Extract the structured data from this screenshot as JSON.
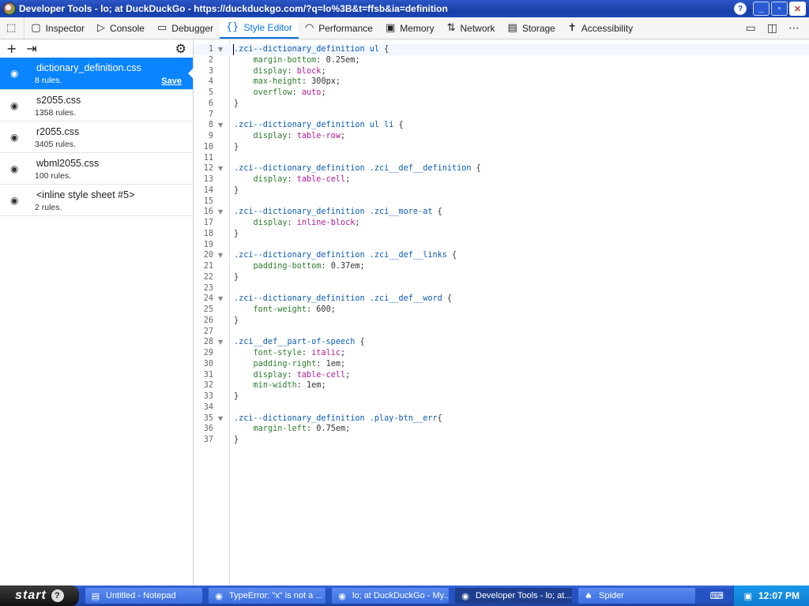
{
  "window": {
    "title": "Developer Tools - lo; at DuckDuckGo - https://duckduckgo.com/?q=lo%3B&t=ffsb&ia=definition",
    "help_glyph": "?",
    "minimize_glyph": "_",
    "maximize_glyph": "▫",
    "close_glyph": "✕"
  },
  "toolbar": {
    "tabs": [
      {
        "label": "Inspector",
        "icon": "inspector-icon",
        "glyph": "▢"
      },
      {
        "label": "Console",
        "icon": "console-icon",
        "glyph": "▷"
      },
      {
        "label": "Debugger",
        "icon": "debugger-icon",
        "glyph": "▭"
      },
      {
        "label": "Style Editor",
        "icon": "style-editor-icon",
        "glyph": "{}"
      },
      {
        "label": "Performance",
        "icon": "performance-icon",
        "glyph": "◠"
      },
      {
        "label": "Memory",
        "icon": "memory-icon",
        "glyph": "▣"
      },
      {
        "label": "Network",
        "icon": "network-icon",
        "glyph": "⇅"
      },
      {
        "label": "Storage",
        "icon": "storage-icon",
        "glyph": "▤"
      },
      {
        "label": "Accessibility",
        "icon": "accessibility-icon",
        "glyph": "✝"
      }
    ],
    "active_tab": "Style Editor",
    "accent_color": "#0a72e0"
  },
  "sidebar": {
    "sheets": [
      {
        "name": "dictionary_definition.css",
        "rules": "8 rules.",
        "selected": true,
        "save_label": "Save"
      },
      {
        "name": "s2055.css",
        "rules": "1358 rules."
      },
      {
        "name": "r2055.css",
        "rules": "3405 rules."
      },
      {
        "name": "wbml2055.css",
        "rules": "100 rules."
      },
      {
        "name": "<inline style sheet #5>",
        "rules": "2 rules."
      }
    ],
    "selected_color": "#0a84ff"
  },
  "editor": {
    "lines": [
      {
        "n": "1",
        "fold": true,
        "tokens": [
          [
            "sel",
            ".zci--dictionary_definition ul"
          ],
          [
            "pun",
            " {"
          ]
        ]
      },
      {
        "n": "2",
        "tokens": [
          [
            "pun",
            "    "
          ],
          [
            "prop",
            "margin-bottom"
          ],
          [
            "pun",
            ": "
          ],
          [
            "pun",
            "0.25em"
          ],
          [
            "pun",
            ";"
          ]
        ]
      },
      {
        "n": "3",
        "tokens": [
          [
            "pun",
            "    "
          ],
          [
            "prop",
            "display"
          ],
          [
            "pun",
            ": "
          ],
          [
            "val",
            "block"
          ],
          [
            "pun",
            ";"
          ]
        ]
      },
      {
        "n": "4",
        "tokens": [
          [
            "pun",
            "    "
          ],
          [
            "prop",
            "max-height"
          ],
          [
            "pun",
            ": "
          ],
          [
            "pun",
            "300px"
          ],
          [
            "pun",
            ";"
          ]
        ]
      },
      {
        "n": "5",
        "tokens": [
          [
            "pun",
            "    "
          ],
          [
            "prop",
            "overflow"
          ],
          [
            "pun",
            ": "
          ],
          [
            "val",
            "auto"
          ],
          [
            "pun",
            ";"
          ]
        ]
      },
      {
        "n": "6",
        "tokens": [
          [
            "pun",
            "}"
          ]
        ]
      },
      {
        "n": "7",
        "tokens": []
      },
      {
        "n": "8",
        "fold": true,
        "tokens": [
          [
            "sel",
            ".zci--dictionary_definition ul li"
          ],
          [
            "pun",
            " {"
          ]
        ]
      },
      {
        "n": "9",
        "tokens": [
          [
            "pun",
            "    "
          ],
          [
            "prop",
            "display"
          ],
          [
            "pun",
            ": "
          ],
          [
            "val",
            "table-row"
          ],
          [
            "pun",
            ";"
          ]
        ]
      },
      {
        "n": "10",
        "tokens": [
          [
            "pun",
            "}"
          ]
        ]
      },
      {
        "n": "11",
        "tokens": []
      },
      {
        "n": "12",
        "fold": true,
        "tokens": [
          [
            "sel",
            ".zci--dictionary_definition .zci__def__definition"
          ],
          [
            "pun",
            " {"
          ]
        ]
      },
      {
        "n": "13",
        "tokens": [
          [
            "pun",
            "    "
          ],
          [
            "prop",
            "display"
          ],
          [
            "pun",
            ": "
          ],
          [
            "val",
            "table-cell"
          ],
          [
            "pun",
            ";"
          ]
        ]
      },
      {
        "n": "14",
        "tokens": [
          [
            "pun",
            "}"
          ]
        ]
      },
      {
        "n": "15",
        "tokens": []
      },
      {
        "n": "16",
        "fold": true,
        "tokens": [
          [
            "sel",
            ".zci--dictionary_definition .zci__more-at"
          ],
          [
            "pun",
            " {"
          ]
        ]
      },
      {
        "n": "17",
        "tokens": [
          [
            "pun",
            "    "
          ],
          [
            "prop",
            "display"
          ],
          [
            "pun",
            ": "
          ],
          [
            "val",
            "inline-block"
          ],
          [
            "pun",
            ";"
          ]
        ]
      },
      {
        "n": "18",
        "tokens": [
          [
            "pun",
            "}"
          ]
        ]
      },
      {
        "n": "19",
        "tokens": []
      },
      {
        "n": "20",
        "fold": true,
        "tokens": [
          [
            "sel",
            ".zci--dictionary_definition .zci__def__links"
          ],
          [
            "pun",
            " {"
          ]
        ]
      },
      {
        "n": "21",
        "tokens": [
          [
            "pun",
            "    "
          ],
          [
            "prop",
            "padding-bottom"
          ],
          [
            "pun",
            ": "
          ],
          [
            "pun",
            "0.37em"
          ],
          [
            "pun",
            ";"
          ]
        ]
      },
      {
        "n": "22",
        "tokens": [
          [
            "pun",
            "}"
          ]
        ]
      },
      {
        "n": "23",
        "tokens": []
      },
      {
        "n": "24",
        "fold": true,
        "tokens": [
          [
            "sel",
            ".zci--dictionary_definition .zci__def__word"
          ],
          [
            "pun",
            " {"
          ]
        ]
      },
      {
        "n": "25",
        "tokens": [
          [
            "pun",
            "    "
          ],
          [
            "prop",
            "font-weight"
          ],
          [
            "pun",
            ": "
          ],
          [
            "pun",
            "600"
          ],
          [
            "pun",
            ";"
          ]
        ]
      },
      {
        "n": "26",
        "tokens": [
          [
            "pun",
            "}"
          ]
        ]
      },
      {
        "n": "27",
        "tokens": []
      },
      {
        "n": "28",
        "fold": true,
        "tokens": [
          [
            "sel",
            ".zci__def__part-of-speech"
          ],
          [
            "pun",
            " {"
          ]
        ]
      },
      {
        "n": "29",
        "tokens": [
          [
            "pun",
            "    "
          ],
          [
            "prop",
            "font-style"
          ],
          [
            "pun",
            ": "
          ],
          [
            "val",
            "italic"
          ],
          [
            "pun",
            ";"
          ]
        ]
      },
      {
        "n": "30",
        "tokens": [
          [
            "pun",
            "    "
          ],
          [
            "prop",
            "padding-right"
          ],
          [
            "pun",
            ": "
          ],
          [
            "pun",
            "1em"
          ],
          [
            "pun",
            ";"
          ]
        ]
      },
      {
        "n": "31",
        "tokens": [
          [
            "pun",
            "    "
          ],
          [
            "prop",
            "display"
          ],
          [
            "pun",
            ": "
          ],
          [
            "val",
            "table-cell"
          ],
          [
            "pun",
            ";"
          ]
        ]
      },
      {
        "n": "32",
        "tokens": [
          [
            "pun",
            "    "
          ],
          [
            "prop",
            "min-width"
          ],
          [
            "pun",
            ": "
          ],
          [
            "pun",
            "1em"
          ],
          [
            "pun",
            ";"
          ]
        ]
      },
      {
        "n": "33",
        "tokens": [
          [
            "pun",
            "}"
          ]
        ]
      },
      {
        "n": "34",
        "tokens": []
      },
      {
        "n": "35",
        "fold": true,
        "tokens": [
          [
            "sel",
            ".zci--dictionary_definition .play-btn__err"
          ],
          [
            "pun",
            "{"
          ]
        ]
      },
      {
        "n": "36",
        "tokens": [
          [
            "pun",
            "    "
          ],
          [
            "prop",
            "margin-left"
          ],
          [
            "pun",
            ": "
          ],
          [
            "pun",
            "0.75em"
          ],
          [
            "pun",
            ";"
          ]
        ]
      },
      {
        "n": "37",
        "tokens": [
          [
            "pun",
            "}"
          ]
        ]
      }
    ]
  },
  "taskbar": {
    "start_label": "start",
    "tasks": [
      {
        "label": "Untitled - Notepad",
        "icon": "notepad-icon",
        "glyph": "▤"
      },
      {
        "label": "TypeError: \"x\" is not a ...",
        "icon": "browser-icon",
        "glyph": "◉"
      },
      {
        "label": "lo; at DuckDuckGo - My...",
        "icon": "browser-icon",
        "glyph": "◉"
      },
      {
        "label": "Developer Tools - lo; at...",
        "icon": "browser-icon",
        "glyph": "◉",
        "active": true
      },
      {
        "label": "Spider",
        "icon": "spider-solitaire-icon",
        "glyph": "♠"
      }
    ],
    "keyboard_glyph": "⌨",
    "tray_glyph": "▣",
    "clock": "12:07 PM"
  }
}
